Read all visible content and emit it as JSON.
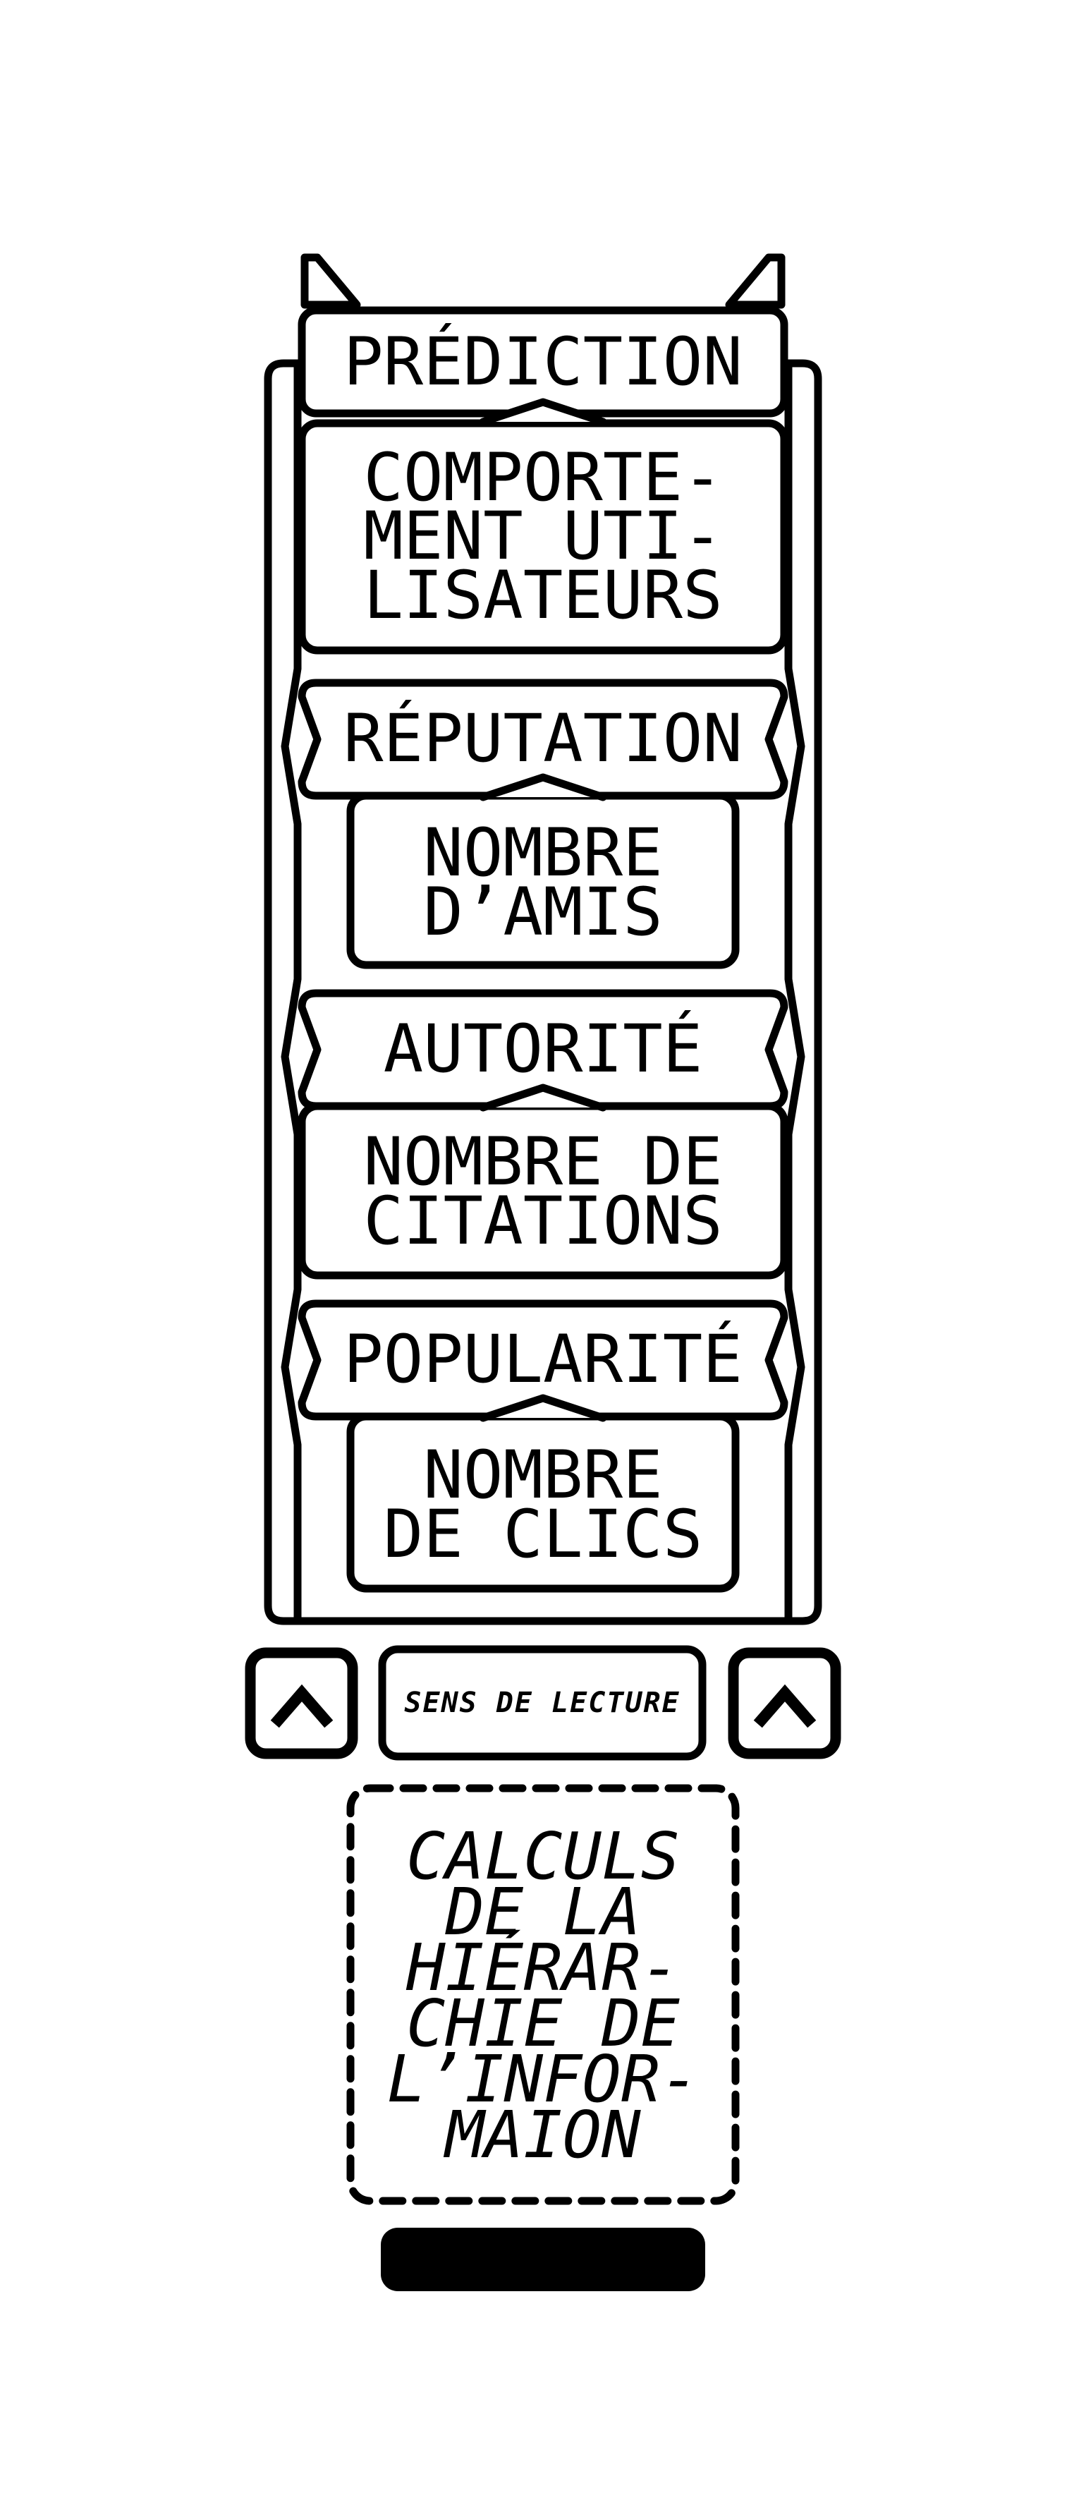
{
  "stack": [
    {
      "tag": "PRÉDICTION",
      "box_lines": [
        "COMPORTE-",
        "MENT UTI-",
        "LISATEURS"
      ]
    },
    {
      "tag": "RÉPUTATION",
      "box_lines": [
        "NOMBRE",
        "D’AMIS"
      ]
    },
    {
      "tag": "AUTORITÉ",
      "box_lines": [
        "NOMBRE DE",
        "CITATIONS"
      ]
    },
    {
      "tag": "POPULARITÉ",
      "box_lines": [
        "NOMBRE",
        "DE CLICS"
      ]
    }
  ],
  "reading_direction": {
    "label": "SENS DE LECTURE",
    "icon": "chevron-up-icon"
  },
  "note_lines": [
    "CALCULS",
    "DE LA",
    "HIÉRAR-",
    "CHIE DE",
    "L’INFOR-",
    "MAION"
  ],
  "colors": {
    "stroke": "#000000",
    "background": "#ffffff"
  }
}
